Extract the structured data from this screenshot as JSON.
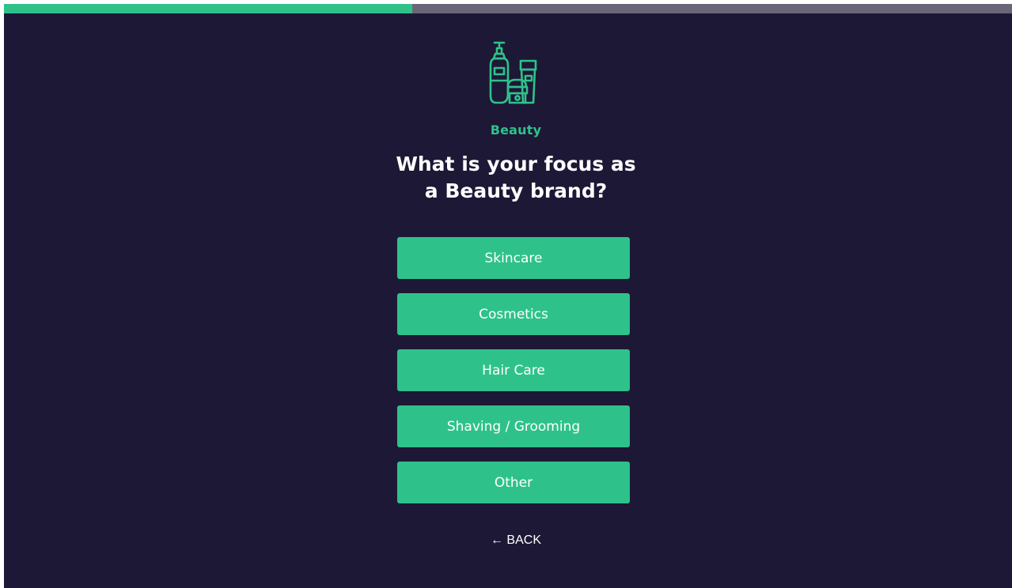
{
  "progress": {
    "fraction": 0.405
  },
  "colors": {
    "accent": "#2ec28a",
    "background": "#1d1836",
    "track": "#6b6578",
    "text": "#ffffff"
  },
  "hero": {
    "icon": "beauty-products-icon",
    "category_label": "Beauty",
    "question_line1": "What is your focus as",
    "question_line2": "a Beauty brand?"
  },
  "options": [
    {
      "label": "Skincare"
    },
    {
      "label": "Cosmetics"
    },
    {
      "label": "Hair Care"
    },
    {
      "label": "Shaving / Grooming"
    },
    {
      "label": "Other"
    }
  ],
  "back": {
    "label": "← BACK"
  }
}
